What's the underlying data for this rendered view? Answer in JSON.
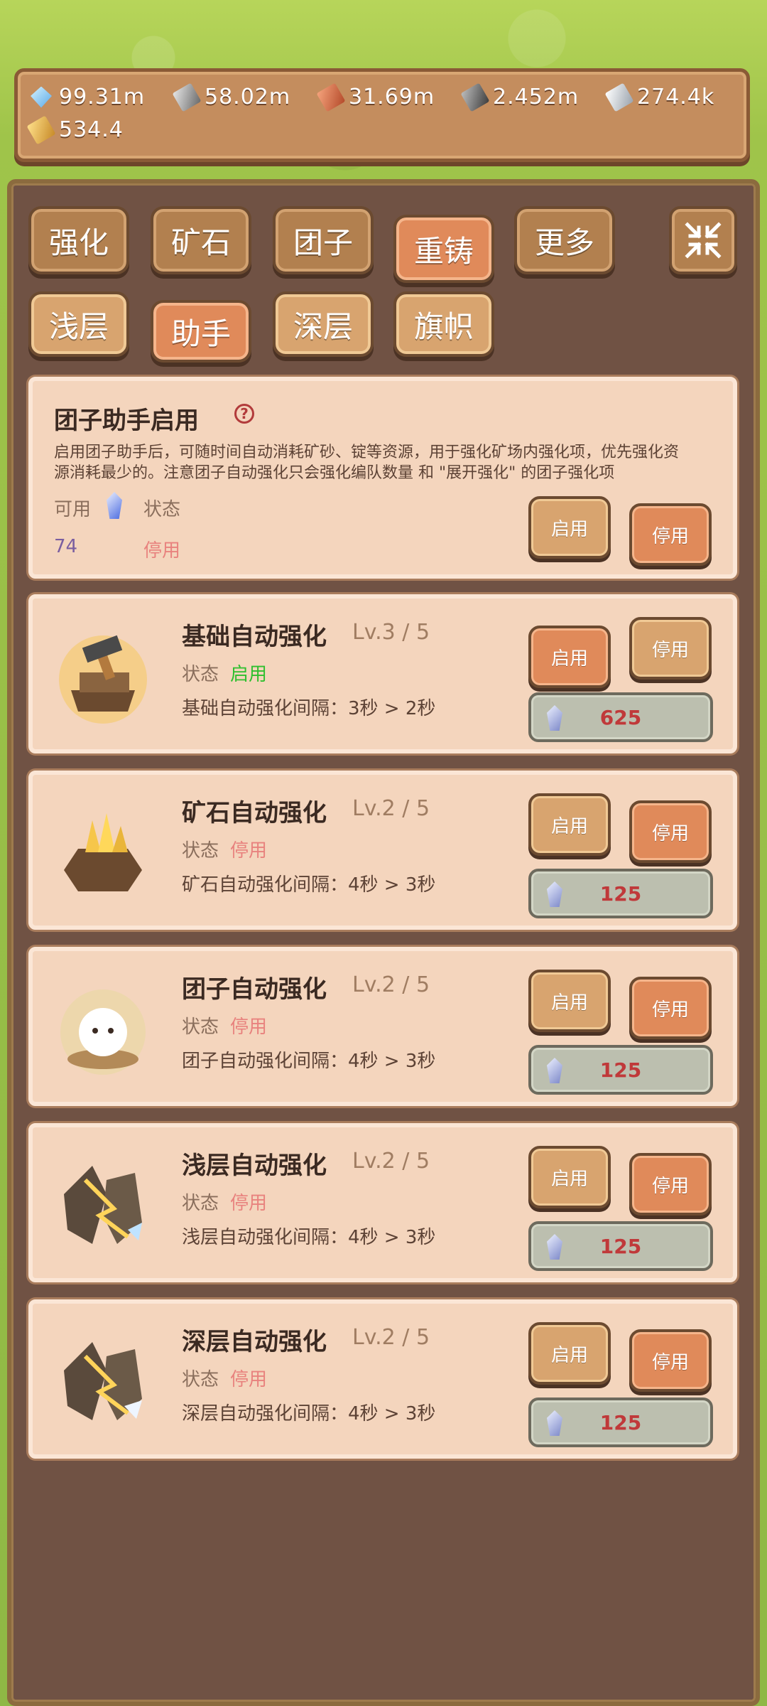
{
  "resources": [
    {
      "icon": "blue-crystal-icon",
      "value": "99.31m"
    },
    {
      "icon": "steel-ingot-icon",
      "value": "58.02m"
    },
    {
      "icon": "copper-ingot-icon",
      "value": "31.69m"
    },
    {
      "icon": "dark-ingot-icon",
      "value": "2.452m"
    },
    {
      "icon": "silver-ingot-icon",
      "value": "274.4k"
    },
    {
      "icon": "gold-ingot-icon",
      "value": "534.4"
    }
  ],
  "tabs_row1": [
    "强化",
    "矿石",
    "团子",
    "重铸",
    "更多"
  ],
  "tabs_row2": [
    "浅层",
    "助手",
    "深层",
    "旗帜"
  ],
  "active_tabs": [
    "重铸",
    "助手"
  ],
  "assistant": {
    "title": "团子助手启用",
    "help_icon": "?",
    "desc_line1": "启用团子助手后，可随时间自动消耗矿砂、锭等资源，用于强化矿场内强化项，优先强化资",
    "desc_line2": "源消耗最少的。注意团子自动强化只会强化编队数量 和 \"展开强化\" 的团子强化项",
    "available_label": "可用",
    "status_label": "状态",
    "available_value": "74",
    "status_value": "停用",
    "enable_label": "启用",
    "disable_label": "停用"
  },
  "upgrades": [
    {
      "title": "基础自动强化",
      "level": "Lv.3 / 5",
      "status_label": "状态",
      "status": "启用",
      "status_on": true,
      "desc": "基础自动强化间隔：3秒 > 2秒",
      "enable_label": "启用",
      "disable_label": "停用",
      "cost": "625",
      "icon": "anvil-icon"
    },
    {
      "title": "矿石自动强化",
      "level": "Lv.2 / 5",
      "status_label": "状态",
      "status": "停用",
      "status_on": false,
      "desc": "矿石自动强化间隔：4秒 > 3秒",
      "enable_label": "启用",
      "disable_label": "停用",
      "cost": "125",
      "icon": "gold-ore-icon"
    },
    {
      "title": "团子自动强化",
      "level": "Lv.2 / 5",
      "status_label": "状态",
      "status": "停用",
      "status_on": false,
      "desc": "团子自动强化间隔：4秒 > 3秒",
      "enable_label": "启用",
      "disable_label": "停用",
      "cost": "125",
      "icon": "dumpling-icon"
    },
    {
      "title": "浅层自动强化",
      "level": "Lv.2 / 5",
      "status_label": "状态",
      "status": "停用",
      "status_on": false,
      "desc": "浅层自动强化间隔：4秒 > 3秒",
      "enable_label": "启用",
      "disable_label": "停用",
      "cost": "125",
      "icon": "shallow-rock-icon"
    },
    {
      "title": "深层自动强化",
      "level": "Lv.2 / 5",
      "status_label": "状态",
      "status": "停用",
      "status_on": false,
      "desc": "深层自动强化间隔：4秒 > 3秒",
      "enable_label": "启用",
      "disable_label": "停用",
      "cost": "125",
      "icon": "deep-rock-icon"
    }
  ],
  "colors": {
    "status_on": "#2fbf2f",
    "status_off": "#e8827e",
    "cost_text": "#c0393a"
  }
}
